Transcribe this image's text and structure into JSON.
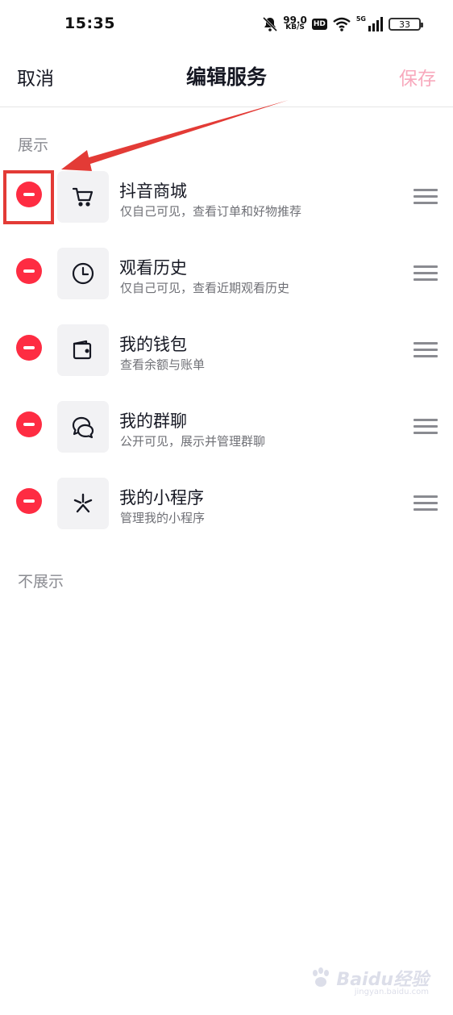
{
  "status_bar": {
    "time": "15:35",
    "net_speed": "99.0",
    "net_unit": "KB/S",
    "hd": "HD",
    "signal": "5G",
    "battery": "33"
  },
  "nav": {
    "cancel": "取消",
    "title": "编辑服务",
    "save": "保存"
  },
  "sections": {
    "shown": "展示",
    "hidden": "不展示"
  },
  "items": [
    {
      "title": "抖音商城",
      "subtitle": "仅自己可见，查看订单和好物推荐",
      "icon": "cart-icon"
    },
    {
      "title": "观看历史",
      "subtitle": "仅自己可见，查看近期观看历史",
      "icon": "clock-icon"
    },
    {
      "title": "我的钱包",
      "subtitle": "查看余额与账单",
      "icon": "wallet-icon"
    },
    {
      "title": "我的群聊",
      "subtitle": "公开可见，展示并管理群聊",
      "icon": "chat-icon"
    },
    {
      "title": "我的小程序",
      "subtitle": "管理我的小程序",
      "icon": "miniprogram-icon"
    }
  ],
  "colors": {
    "remove": "#fe2c42",
    "save_disabled": "#f8a9bd",
    "annotation": "#e33b36"
  },
  "watermark": {
    "brand": "Baidu经验",
    "url": "jingyan.baidu.com"
  }
}
